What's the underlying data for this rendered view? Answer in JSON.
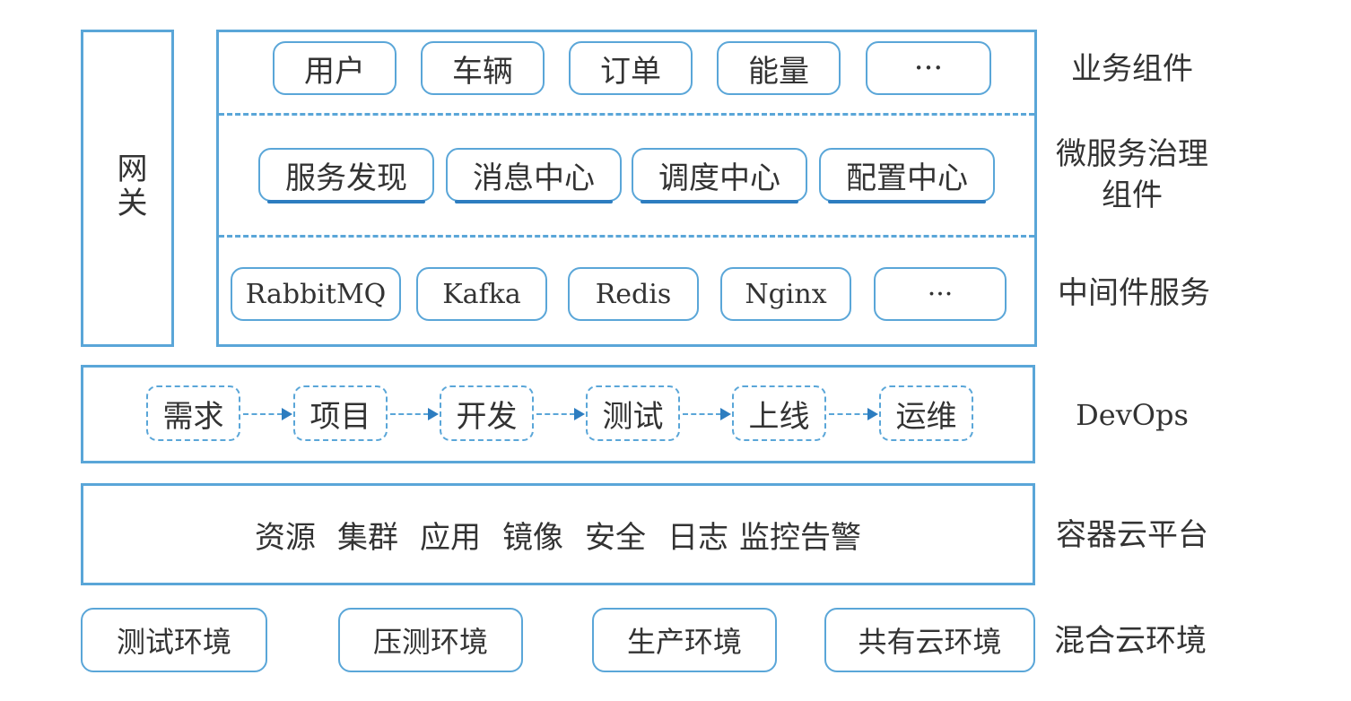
{
  "gateway": {
    "label": "网关"
  },
  "business": {
    "side_label": "业务组件",
    "items": [
      "用户",
      "车辆",
      "订单",
      "能量",
      "···"
    ]
  },
  "governance": {
    "side_label_line1": "微服务治理",
    "side_label_line2": "组件",
    "items": [
      "服务发现",
      "消息中心",
      "调度中心",
      "配置中心"
    ]
  },
  "middleware": {
    "side_label": "中间件服务",
    "items": [
      "RabbitMQ",
      "Kafka",
      "Redis",
      "Nginx",
      "···"
    ]
  },
  "devops": {
    "side_label": "DevOps",
    "steps": [
      "需求",
      "项目",
      "开发",
      "测试",
      "上线",
      "运维"
    ]
  },
  "container_cloud": {
    "side_label": "容器云平台",
    "items": [
      "资源",
      "集群",
      "应用",
      "镜像",
      "安全",
      "日志",
      "监控告警"
    ]
  },
  "hybrid_cloud": {
    "side_label": "混合云环境",
    "items": [
      "测试环境",
      "压测环境",
      "生产环境",
      "共有云环境"
    ]
  },
  "colors": {
    "border": "#5aa6d8",
    "accent": "#2d7dc0"
  }
}
